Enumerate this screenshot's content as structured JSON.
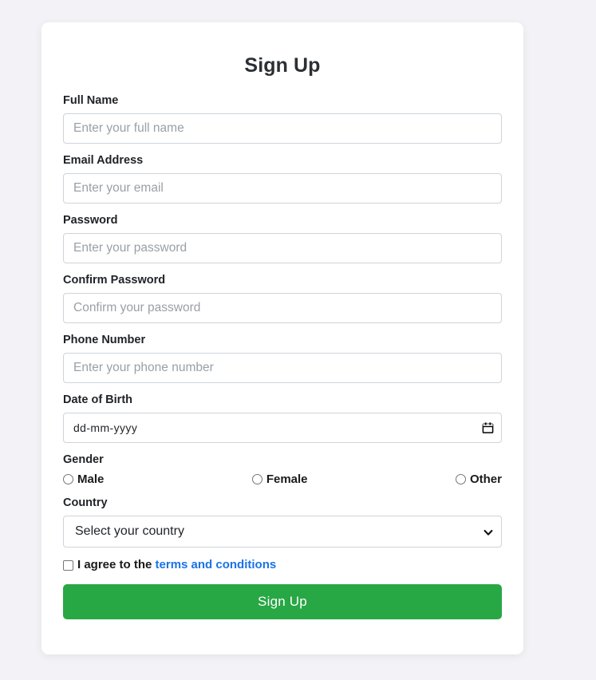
{
  "page": {
    "background_color": "#f3f3f7",
    "card_background": "#ffffff",
    "title": "Sign Up"
  },
  "form": {
    "fields": [
      {
        "key": "full_name",
        "label": "Full Name",
        "placeholder": "Enter your full name",
        "value": ""
      },
      {
        "key": "email",
        "label": "Email Address",
        "placeholder": "Enter your email",
        "value": ""
      },
      {
        "key": "password",
        "label": "Password",
        "placeholder": "Enter your password",
        "value": ""
      },
      {
        "key": "confirm_password",
        "label": "Confirm Password",
        "placeholder": "Confirm your password",
        "value": ""
      },
      {
        "key": "phone",
        "label": "Phone Number",
        "placeholder": "Enter your phone number",
        "value": ""
      }
    ],
    "date_of_birth": {
      "label": "Date of Birth",
      "display_value": "dd-mm-yyyy",
      "icon": "calendar-icon"
    },
    "gender": {
      "label": "Gender",
      "options": [
        {
          "label": "Male",
          "checked": false
        },
        {
          "label": "Female",
          "checked": false
        },
        {
          "label": "Other",
          "checked": false
        }
      ]
    },
    "country": {
      "label": "Country",
      "selected": "Select your country",
      "icon": "chevron-down-icon"
    },
    "terms": {
      "checked": false,
      "text_before": "I agree to the ",
      "link_text": "terms and conditions",
      "link_color": "#1a73e8"
    },
    "submit": {
      "label": "Sign Up",
      "color": "#28a745",
      "text_color": "#ffffff"
    }
  }
}
